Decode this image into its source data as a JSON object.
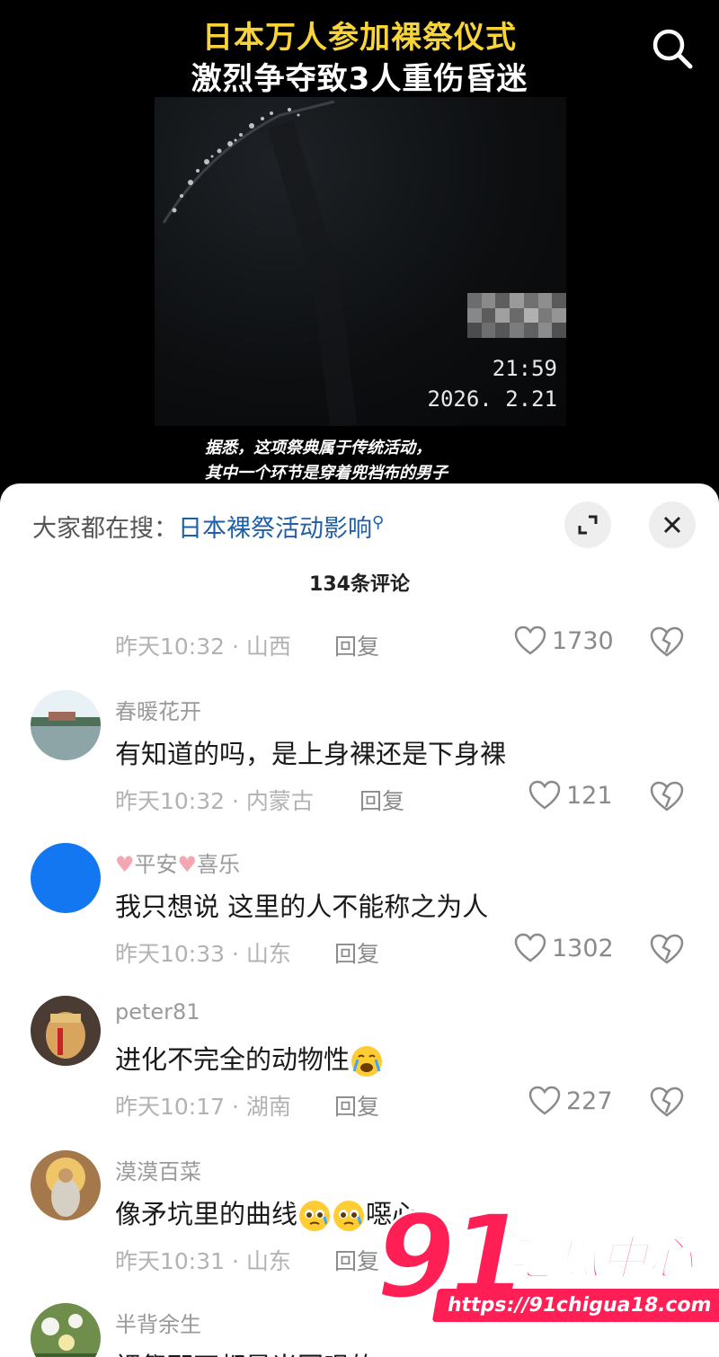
{
  "video": {
    "title_line1": "日本万人参加裸祭仪式",
    "title_line2": "激烈争夺致3人重伤昏迷",
    "timestamp_time": "21:59",
    "timestamp_date": "2026. 2.21",
    "subtitle_line1": "据悉，这项祭典属于传统活动，",
    "subtitle_line2": "其中一个环节是穿着兜裆布的男子"
  },
  "sheet": {
    "search_prefix": "大家都在搜：",
    "search_keyword": "日本裸祭活动影响",
    "comment_count": "134条评论"
  },
  "comments": [
    {
      "username": "",
      "text": "",
      "time": "昨天10:32",
      "location": "山西",
      "reply": "回复",
      "likes": "1730"
    },
    {
      "username": "春暖花开",
      "text": "有知道的吗，是上身裸还是下身裸",
      "time": "昨天10:32",
      "location": "内蒙古",
      "reply": "回复",
      "likes": "121"
    },
    {
      "username": "平安",
      "username_b": "喜乐",
      "text": "我只想说 这里的人不能称之为人",
      "time": "昨天10:33",
      "location": "山东",
      "reply": "回复",
      "likes": "1302"
    },
    {
      "username": "peter81",
      "text": "进化不完全的动物性",
      "time": "昨天10:17",
      "location": "湖南",
      "reply": "回复",
      "likes": "227"
    },
    {
      "username": "漠漠百菜",
      "text": "像矛坑里的曲线",
      "text_tail": "噁心",
      "time": "昨天10:31",
      "location": "山东",
      "reply": "回复",
      "likes": ""
    },
    {
      "username": "半背余生",
      "text": "裸祭那不都是当回哏的",
      "time": "",
      "location": "",
      "reply": "",
      "likes": ""
    }
  ],
  "separator": " · ",
  "watermark": {
    "number": "91",
    "brand": "吃瓜中心",
    "url": "https://91chigua18.com"
  },
  "colors": {
    "title_yellow": "#f7d43a",
    "link_blue": "#1f5fa8",
    "watermark_red": "#ff1f55"
  },
  "icons": {
    "search": "search-icon",
    "expand": "expand-icon",
    "close": "close-icon",
    "like": "heart-icon",
    "dislike": "broken-heart-icon"
  }
}
